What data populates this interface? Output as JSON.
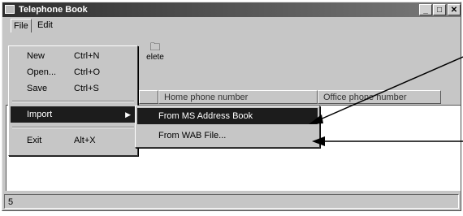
{
  "window": {
    "title": "Telephone Book"
  },
  "title_buttons": {
    "minimize": "_",
    "maximize": "□",
    "close": "✕"
  },
  "menubar": {
    "file": "File",
    "edit": "Edit"
  },
  "toolbar": {
    "delete_label": "elete",
    "delete_icon": "folder-delete-icon"
  },
  "columns": [
    "",
    "Home phone number",
    "Office phone number"
  ],
  "file_menu": [
    {
      "label": "New",
      "accel": "Ctrl+N"
    },
    {
      "label": "Open...",
      "accel": "Ctrl+O"
    },
    {
      "label": "Save",
      "accel": "Ctrl+S"
    },
    {
      "label": "Import",
      "accel": "",
      "submenu": true
    },
    {
      "label": "Exit",
      "accel": "Alt+X"
    }
  ],
  "import_submenu": [
    {
      "label": "From MS Address Book"
    },
    {
      "label": "From WAB File..."
    }
  ],
  "statusbar": {
    "text": "5"
  },
  "colors": {
    "highlight": "#1c1c1c",
    "face": "#c6c6c6"
  }
}
